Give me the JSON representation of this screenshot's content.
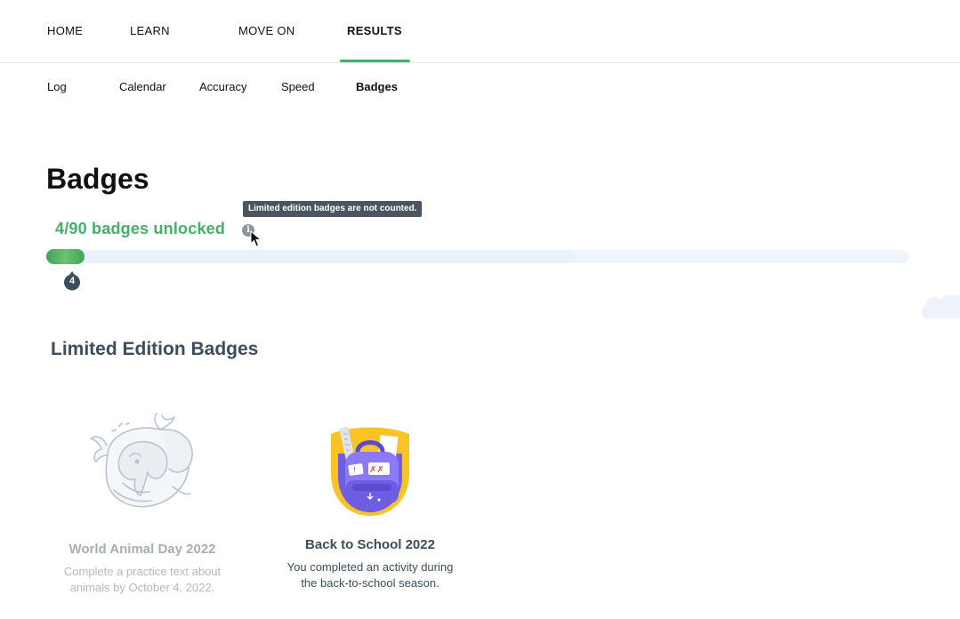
{
  "topnav": {
    "items": [
      {
        "label": "HOME"
      },
      {
        "label": "LEARN"
      },
      {
        "label": "MOVE ON"
      },
      {
        "label": "RESULTS"
      }
    ],
    "active": "RESULTS"
  },
  "subnav": {
    "items": [
      {
        "label": "Log"
      },
      {
        "label": "Calendar"
      },
      {
        "label": "Accuracy"
      },
      {
        "label": "Speed"
      },
      {
        "label": "Badges"
      }
    ],
    "active": "Badges"
  },
  "page": {
    "title": "Badges",
    "unlocked_text": "4/90 badges unlocked",
    "tooltip": "Limited edition badges are not counted.",
    "info_icon": "info-icon",
    "progress": {
      "unlocked": 4,
      "total": 90,
      "marker_label": "4"
    }
  },
  "limited": {
    "title": "Limited Edition Badges",
    "badges": [
      {
        "name": "World Animal Day 2022",
        "desc_line1": "Complete a practice text about",
        "desc_line2": "animals by October 4, 2022.",
        "state": "locked",
        "icon": "whale-elephant-badge-icon"
      },
      {
        "name": "Back to School 2022",
        "desc_line1": "You completed an activity during",
        "desc_line2": "the back-to-school season.",
        "state": "unlocked",
        "icon": "backpack-badge-icon"
      }
    ]
  },
  "colors": {
    "accent_green": "#43b06a",
    "tooltip_bg": "#4b5560",
    "heading_slate": "#3c4d5c",
    "badge_yellow": "#f7c325",
    "badge_purple": "#7d6cf0"
  }
}
